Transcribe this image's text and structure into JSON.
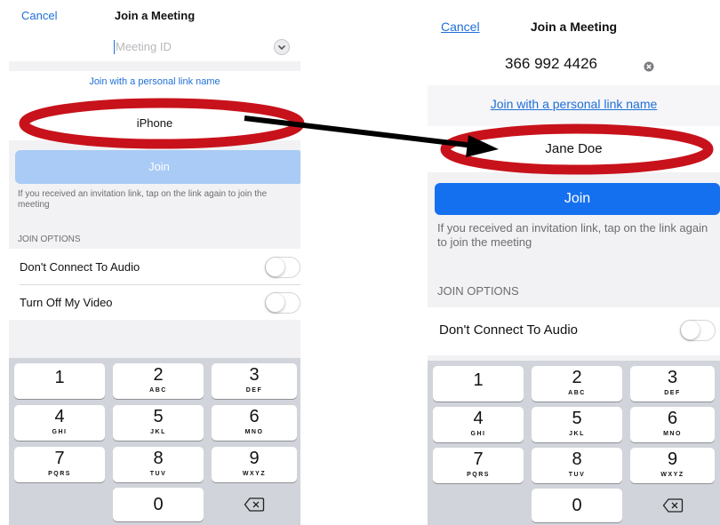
{
  "left": {
    "nav": {
      "cancel": "Cancel",
      "title": "Join a Meeting"
    },
    "meeting_id_placeholder": "Meeting ID",
    "personal_link": "Join with a personal link name",
    "name_value": "iPhone",
    "join_label": "Join",
    "invitation_note": "If you received an invitation link, tap on the link again to join the meeting",
    "options_header": "JOIN OPTIONS",
    "options": [
      "Don't Connect To Audio",
      "Turn Off My Video"
    ]
  },
  "right": {
    "nav": {
      "cancel": "Cancel",
      "title": "Join a Meeting"
    },
    "meeting_id_value": "366 992 4426",
    "personal_link": "Join with a personal link name",
    "name_value": "Jane Doe",
    "join_label": "Join",
    "invitation_note": "If you received an invitation link, tap on the link again to join the meeting",
    "options_header": "JOIN OPTIONS",
    "options": [
      "Don't Connect To Audio"
    ]
  },
  "keypad": {
    "keys": [
      {
        "digit": "1",
        "letters": ""
      },
      {
        "digit": "2",
        "letters": "ABC"
      },
      {
        "digit": "3",
        "letters": "DEF"
      },
      {
        "digit": "4",
        "letters": "GHI"
      },
      {
        "digit": "5",
        "letters": "JKL"
      },
      {
        "digit": "6",
        "letters": "MNO"
      },
      {
        "digit": "7",
        "letters": "PQRS"
      },
      {
        "digit": "8",
        "letters": "TUV"
      },
      {
        "digit": "9",
        "letters": "WXYZ"
      },
      {
        "digit": "0",
        "letters": ""
      }
    ]
  },
  "colors": {
    "accent": "#1f6fd8",
    "join_enabled": "#1570ef",
    "join_disabled": "#a9cbf5",
    "annotation_red": "#c8121b",
    "keypad_bg": "#d1d4da"
  },
  "icons": {
    "clear": "clear-text-icon",
    "dropdown": "chevron-down-icon",
    "backspace": "backspace-icon",
    "arrow": "annotation-arrow"
  }
}
